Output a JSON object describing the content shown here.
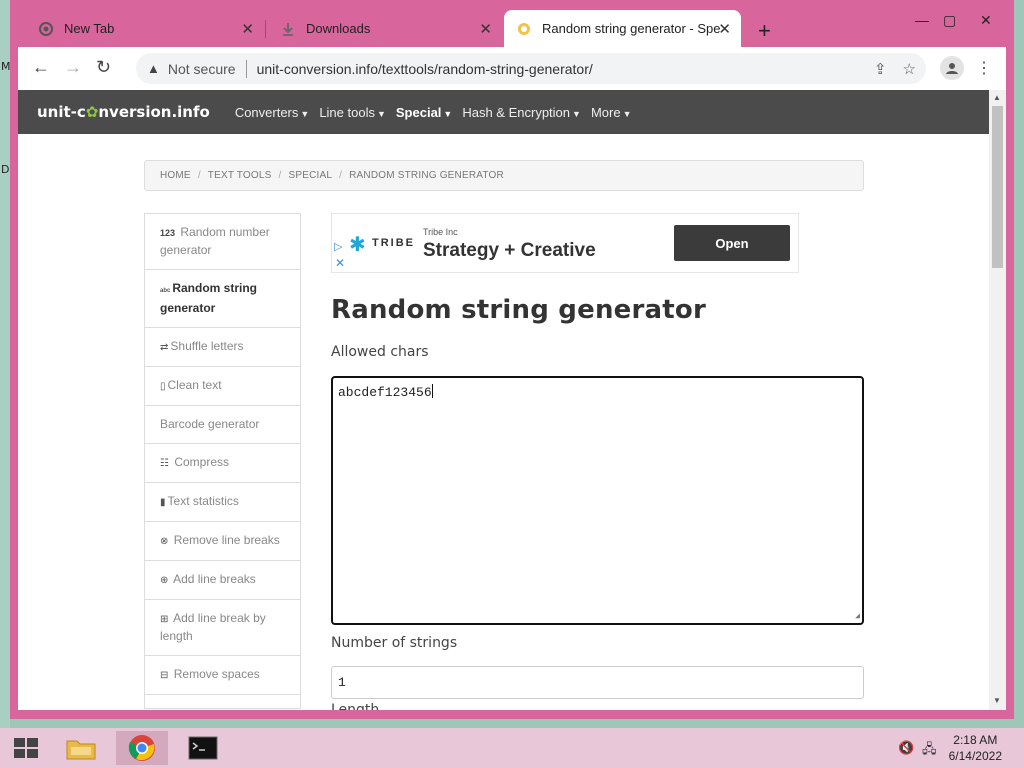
{
  "desktop": {
    "glyphs": [
      "M",
      "D"
    ]
  },
  "tabs": [
    {
      "title": "New Tab",
      "icon": "chrome-icon"
    },
    {
      "title": "Downloads",
      "icon": "download-icon"
    },
    {
      "title": "Random string generator - Speci",
      "icon": "site-favicon"
    }
  ],
  "window_controls": {
    "minimize": "—",
    "maximize": "▢",
    "close": "✕",
    "new_tab": "+"
  },
  "address": {
    "security": "Not secure",
    "url": "unit-conversion.info/texttools/random-string-generator/"
  },
  "site": {
    "logo_prefix": "unit-c",
    "logo_suffix": "nversion.info",
    "menu": [
      {
        "label": "Converters",
        "bold": false
      },
      {
        "label": "Line tools",
        "bold": false
      },
      {
        "label": "Special",
        "bold": true
      },
      {
        "label": "Hash & Encryption",
        "bold": false
      },
      {
        "label": "More",
        "bold": false
      }
    ]
  },
  "breadcrumb": [
    "HOME",
    "TEXT TOOLS",
    "SPECIAL",
    "RANDOM STRING GENERATOR"
  ],
  "sidebar": [
    {
      "icon": "123",
      "label": "Random number generator",
      "active": false
    },
    {
      "icon": "abc",
      "label": "Random string generator",
      "active": true
    },
    {
      "icon": "⇄",
      "label": "Shuffle letters",
      "active": false
    },
    {
      "icon": "▯",
      "label": "Clean text",
      "active": false
    },
    {
      "icon": "",
      "label": "Barcode generator",
      "active": false
    },
    {
      "icon": "☷",
      "label": "Compress",
      "active": false
    },
    {
      "icon": "▮",
      "label": "Text statistics",
      "active": false
    },
    {
      "icon": "⊗",
      "label": "Remove line breaks",
      "active": false
    },
    {
      "icon": "⊕",
      "label": "Add line breaks",
      "active": false
    },
    {
      "icon": "⊞",
      "label": "Add line break by length",
      "active": false
    },
    {
      "icon": "⊟",
      "label": "Remove spaces",
      "active": false
    }
  ],
  "ad": {
    "brand": "TRIBE",
    "advertiser": "Tribe Inc",
    "headline": "Strategy + Creative",
    "cta": "Open"
  },
  "main": {
    "title": "Random string generator",
    "allowed_label": "Allowed chars",
    "allowed_value": "abcdef123456",
    "count_label": "Number of strings",
    "count_value": "1",
    "length_label": "Length"
  },
  "taskbar": {
    "time": "2:18 AM",
    "date": "6/14/2022"
  },
  "colors": {
    "window_frame": "#d8659b",
    "site_header": "#4b4b4b",
    "logo_accent": "#8dc63f",
    "taskbar": "#e8c8d8"
  }
}
